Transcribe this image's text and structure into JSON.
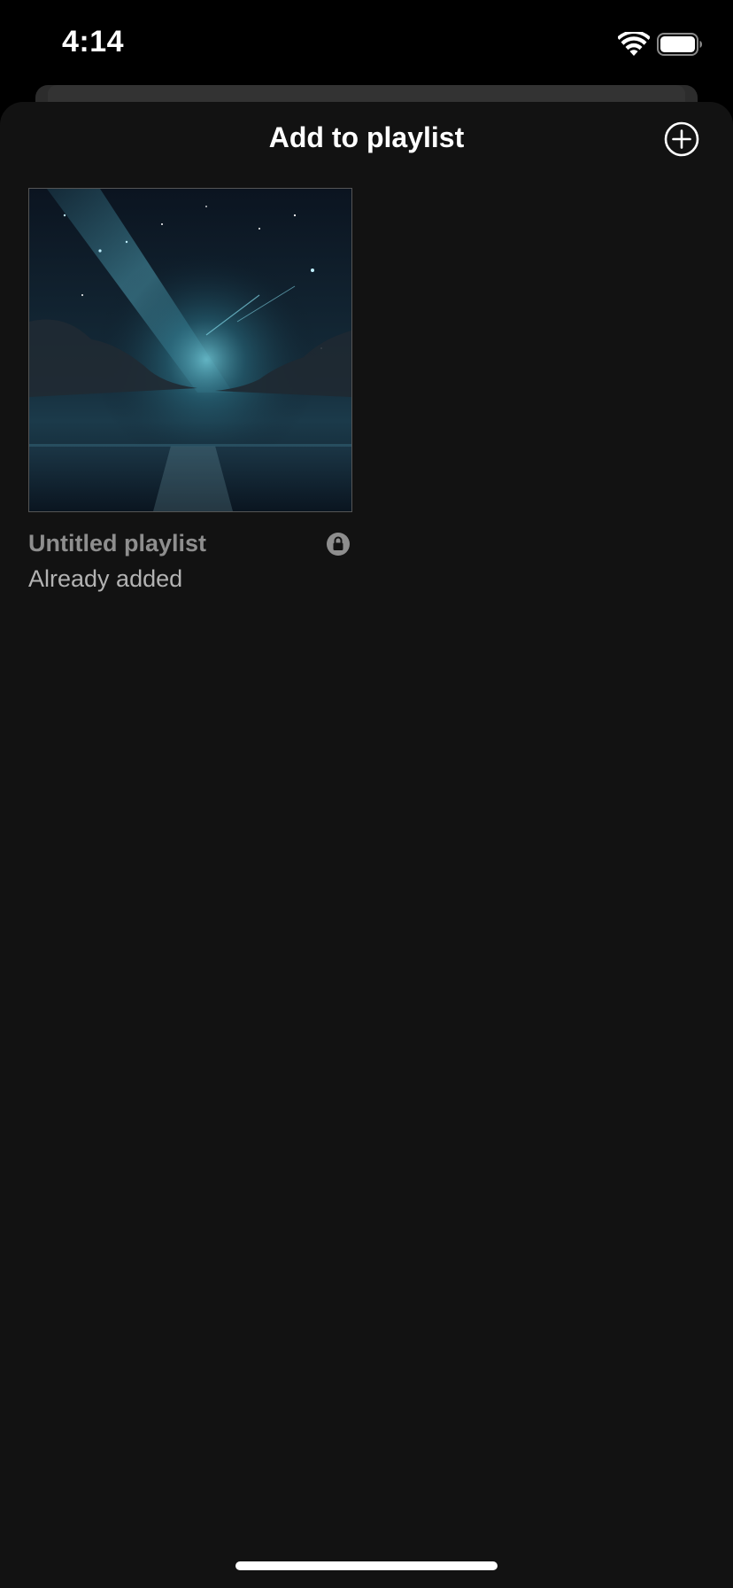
{
  "status_bar": {
    "time": "4:14",
    "wifi_icon": "wifi-icon",
    "battery_icon": "battery-icon"
  },
  "sheet": {
    "title": "Add to playlist",
    "add_icon": "plus-circle-icon"
  },
  "playlists": [
    {
      "name": "Untitled playlist",
      "status": "Already added",
      "private_icon": "lock-icon",
      "cover_icon": "night-sky-cover-art"
    }
  ],
  "colors": {
    "sheet_background": "#121212",
    "title": "#ffffff",
    "playlist_name": "#8e8e8e",
    "playlist_status": "#b3b3b3"
  }
}
